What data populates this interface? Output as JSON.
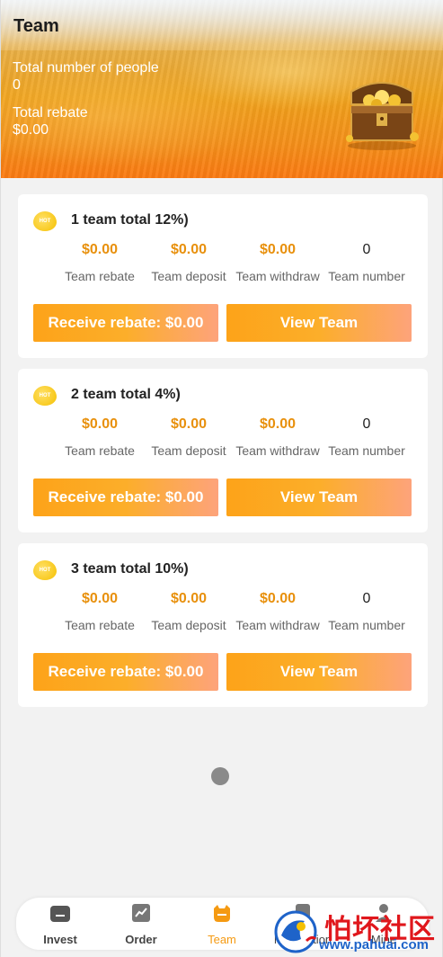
{
  "header": {
    "title": "Team",
    "total_people_label": "Total number of people",
    "total_people_value": "0",
    "total_rebate_label": "Total rebate",
    "total_rebate_value": "$0.00"
  },
  "cards": [
    {
      "icon": "hot-icon",
      "title": "1 team total 12%)",
      "stats": [
        {
          "value": "$0.00",
          "label": "Team rebate"
        },
        {
          "value": "$0.00",
          "label": "Team deposit"
        },
        {
          "value": "$0.00",
          "label": "Team withdraw"
        },
        {
          "value": "0",
          "label": "Team number"
        }
      ],
      "receive_button": "Receive rebate: $0.00",
      "view_button": "View Team"
    },
    {
      "icon": "hot-icon",
      "title": "2 team total 4%)",
      "stats": [
        {
          "value": "$0.00",
          "label": "Team rebate"
        },
        {
          "value": "$0.00",
          "label": "Team deposit"
        },
        {
          "value": "$0.00",
          "label": "Team withdraw"
        },
        {
          "value": "0",
          "label": "Team number"
        }
      ],
      "receive_button": "Receive rebate: $0.00",
      "view_button": "View Team"
    },
    {
      "icon": "hot-icon",
      "title": "3 team total 10%)",
      "stats": [
        {
          "value": "$0.00",
          "label": "Team rebate"
        },
        {
          "value": "$0.00",
          "label": "Team deposit"
        },
        {
          "value": "$0.00",
          "label": "Team withdraw"
        },
        {
          "value": "0",
          "label": "Team number"
        }
      ],
      "receive_button": "Receive rebate: $0.00",
      "view_button": "View Team"
    }
  ],
  "nav": {
    "items": [
      {
        "label": "Invest",
        "icon": "invest-icon"
      },
      {
        "label": "Order",
        "icon": "chart-icon"
      },
      {
        "label": "Team",
        "icon": "team-icon",
        "active": true
      },
      {
        "label": "Notification",
        "icon": "notification-icon"
      },
      {
        "label": "Mine",
        "icon": "user-icon"
      }
    ]
  },
  "watermark": {
    "text": "怕坏社区",
    "url": "www.pahuai.com"
  },
  "colors": {
    "accent": "#f59a12",
    "value_orange": "#e8900c"
  }
}
